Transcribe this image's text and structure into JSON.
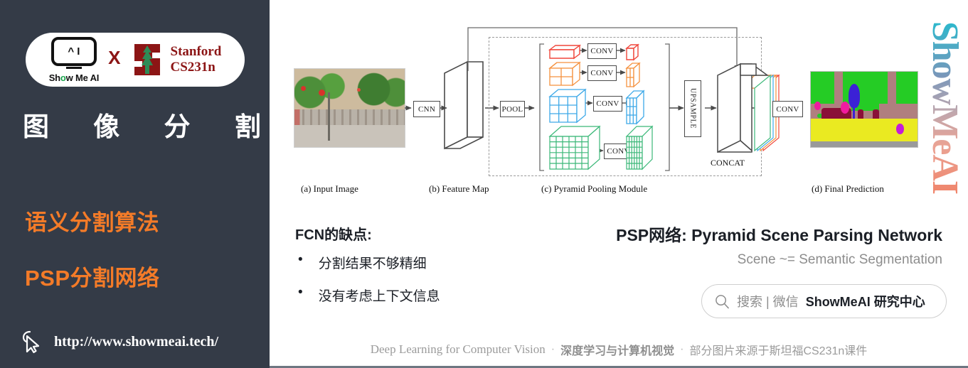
{
  "sidebar": {
    "logo": {
      "showmeai_badge_text": "^ I",
      "showmeai_wordmark_pre": "Sh",
      "showmeai_wordmark_o": "o",
      "showmeai_wordmark_post": "w Me AI",
      "cross": "X",
      "stanford_line1": "Stanford",
      "stanford_line2": "CS231n",
      "stanford_icon": "stanford-tree-icon",
      "stanford_color": "#8C1515"
    },
    "title": "图 像 分 割",
    "subtitle_1": "语义分割算法",
    "subtitle_2": "PSP分割网络",
    "url": "http://www.showmeai.tech/",
    "cursor_icon": "cursor-pointer-icon",
    "background_color": "#343B47",
    "accent_color": "#F47B28",
    "title_color": "#FFFFFF"
  },
  "figure": {
    "boxes": {
      "cnn": "CNN",
      "pool": "POOL",
      "conv": "CONV",
      "upsample": "UPSAMPLE",
      "concat": "CONCAT"
    },
    "conv_labels": [
      "CONV",
      "CONV",
      "CONV",
      "CONV"
    ],
    "captions": [
      "(a) Input Image",
      "(b) Feature Map",
      "(c) Pyramid Pooling Module",
      "(d) Final Prediction"
    ],
    "pyramid_levels": [
      {
        "grid": "1x1",
        "color": "#F0473C"
      },
      {
        "grid": "2x2",
        "color": "#F5913E"
      },
      {
        "grid": "3x3",
        "color": "#3DA9E8"
      },
      {
        "grid": "6x6",
        "color": "#3BB878"
      }
    ],
    "watermark": "ShowMeAI"
  },
  "content": {
    "fcn_heading": "FCN的缺点:",
    "fcn_bullets": [
      "分割结果不够精细",
      "没有考虑上下文信息"
    ],
    "bullet_glyph": "•",
    "psp_heading": "PSP网络: Pyramid Scene Parsing Network",
    "psp_subheading": "Scene ~= Semantic Segmentation",
    "search": {
      "icon": "search-icon",
      "label_gray": "搜索 | 微信",
      "label_bold": "ShowMeAI 研究中心"
    },
    "footer": {
      "english": "Deep Learning for Computer Vision",
      "sep1": "·",
      "chinese_bold": "深度学习与计算机视觉",
      "sep2": "·",
      "source": "部分图片来源于斯坦福CS231n课件"
    }
  }
}
